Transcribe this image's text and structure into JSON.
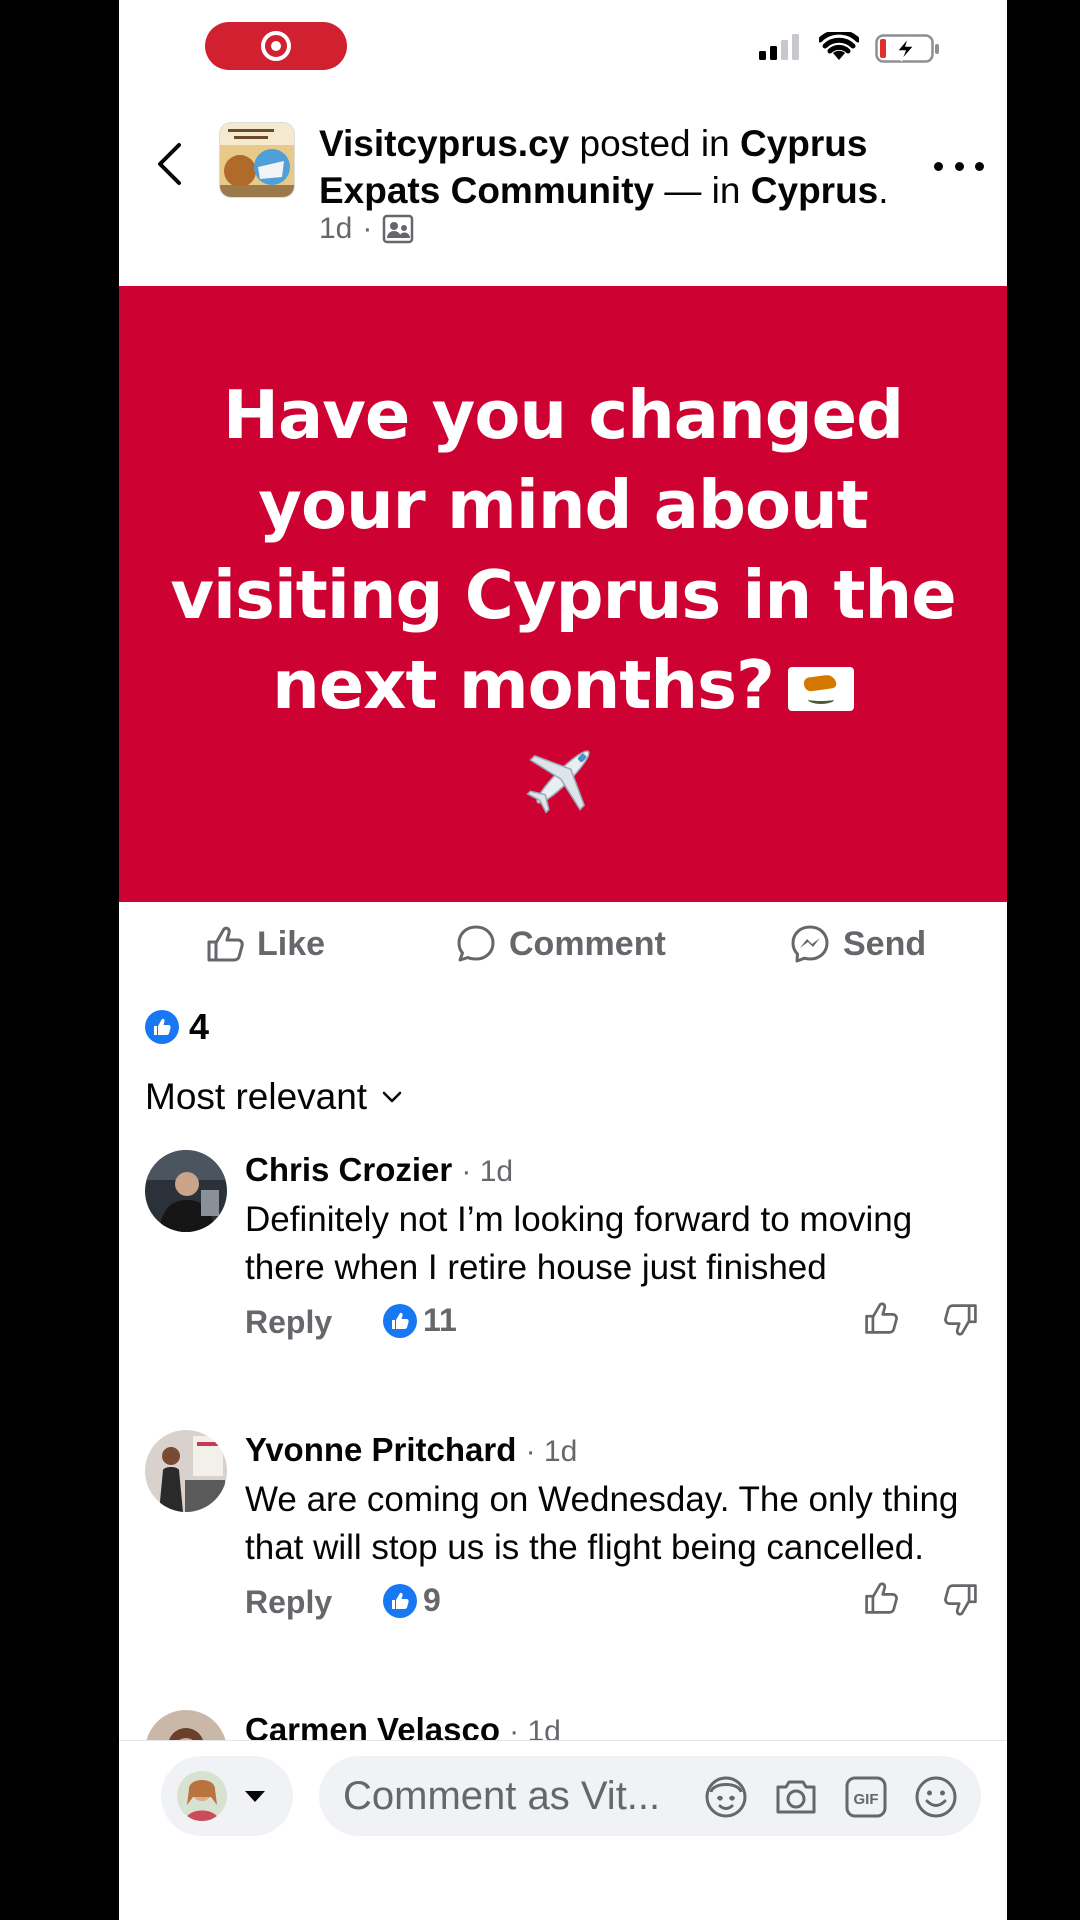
{
  "colors": {
    "accent": "#1877f2",
    "banner": "#cd0232",
    "recording": "#d1202f",
    "muted_text": "#65676b"
  },
  "status_bar": {
    "recording_icon": "record-icon",
    "signal_icon": "cellular-signal-icon",
    "wifi_icon": "wifi-icon",
    "battery_icon": "battery-charging-icon"
  },
  "post_header": {
    "author": "Visitcyprus.cy",
    "posted_in": " posted in ",
    "group": "Cyprus Expats Community",
    "in_sep": " — in ",
    "location": "Cyprus",
    "period": ".",
    "time": "1d",
    "dot": "·",
    "audience_icon": "group-audience-icon"
  },
  "banner": {
    "text": "Have you changed your mind about visiting Cyprus in the next months?",
    "emoji_flag": "cyprus-flag-icon",
    "emoji_plane": "airplane-icon"
  },
  "actions": {
    "like": "Like",
    "comment": "Comment",
    "send": "Send"
  },
  "reactions": {
    "count": "4"
  },
  "sort": {
    "label": "Most relevant"
  },
  "comments": [
    {
      "name": "Chris Crozier",
      "time": "· 1d",
      "text": "Definitely not I’m looking forward to moving there when I retire house just finished",
      "reply": "Reply",
      "likes": "11"
    },
    {
      "name": "Yvonne Pritchard",
      "time": "· 1d",
      "text": "We are coming on Wednesday. The only thing that will stop us is the flight being cancelled.",
      "reply": "Reply",
      "likes": "9"
    },
    {
      "name": "Carmen Velasco",
      "time": "· 1d"
    }
  ],
  "composer": {
    "placeholder": "Comment as Vit..."
  }
}
